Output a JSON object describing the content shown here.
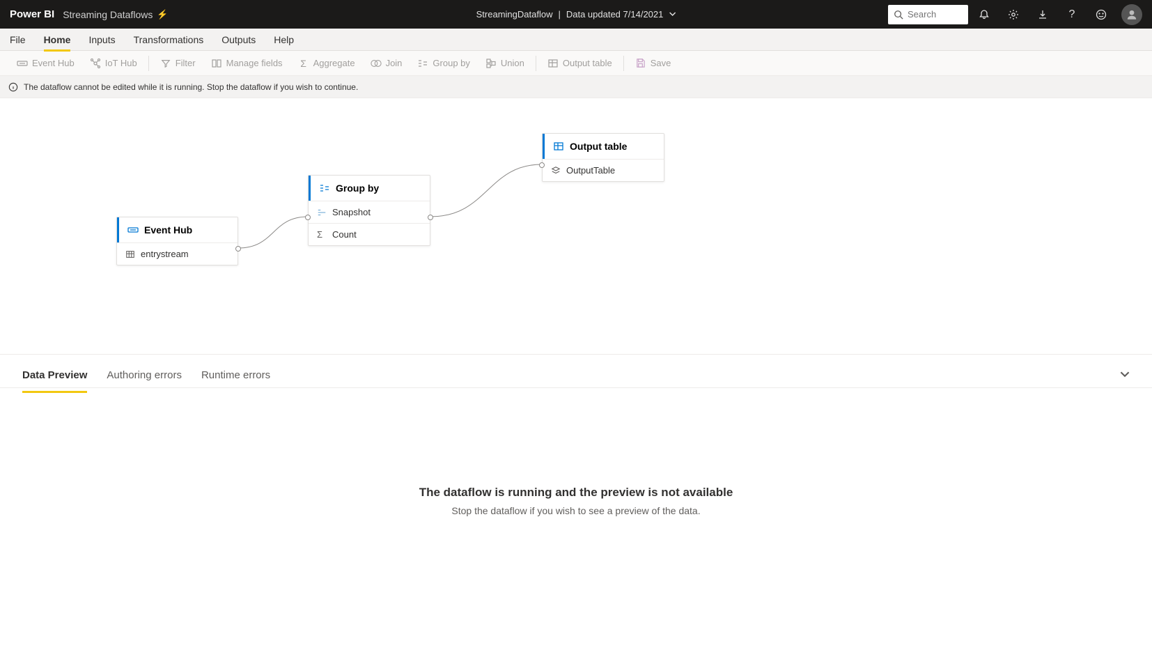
{
  "topbar": {
    "product": "Power BI",
    "app": "Streaming Dataflows",
    "center_name": "StreamingDataflow",
    "center_status": "Data updated 7/14/2021",
    "search_placeholder": "Search"
  },
  "ribbon": {
    "tabs": [
      "File",
      "Home",
      "Inputs",
      "Transformations",
      "Outputs",
      "Help"
    ]
  },
  "toolbar": {
    "event_hub": "Event Hub",
    "iot_hub": "IoT Hub",
    "filter": "Filter",
    "manage_fields": "Manage fields",
    "aggregate": "Aggregate",
    "join": "Join",
    "group_by": "Group by",
    "union": "Union",
    "output_table": "Output table",
    "save": "Save"
  },
  "infobar": {
    "message": "The dataflow cannot be edited while it is running. Stop the dataflow if you wish to continue."
  },
  "nodes": {
    "event_hub": {
      "title": "Event Hub",
      "row1": "entrystream"
    },
    "group_by": {
      "title": "Group by",
      "row1": "Snapshot",
      "row2": "Count"
    },
    "output": {
      "title": "Output table",
      "row1": "OutputTable"
    }
  },
  "bottom": {
    "tabs": [
      "Data Preview",
      "Authoring errors",
      "Runtime errors"
    ],
    "preview_title": "The dataflow is running and the preview is not available",
    "preview_sub": "Stop the dataflow if you wish to see a preview of the data."
  }
}
